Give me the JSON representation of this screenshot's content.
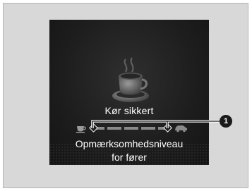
{
  "display": {
    "message": "Kør sikkert",
    "level_label_line1": "Opmærksomhedsniveau",
    "level_label_line2": "for fører",
    "icons": {
      "cup": "coffee-cup-icon",
      "level_start": "small-cup-icon",
      "level_end": "car-icon"
    }
  },
  "callout": {
    "number": "1"
  },
  "colors": {
    "panel_background": "#d8d8d8",
    "screen_background": "#1d1d1d",
    "text": "#ffffff",
    "segment": "#8a8a8a",
    "callout_badge": "#1a1a1a"
  }
}
